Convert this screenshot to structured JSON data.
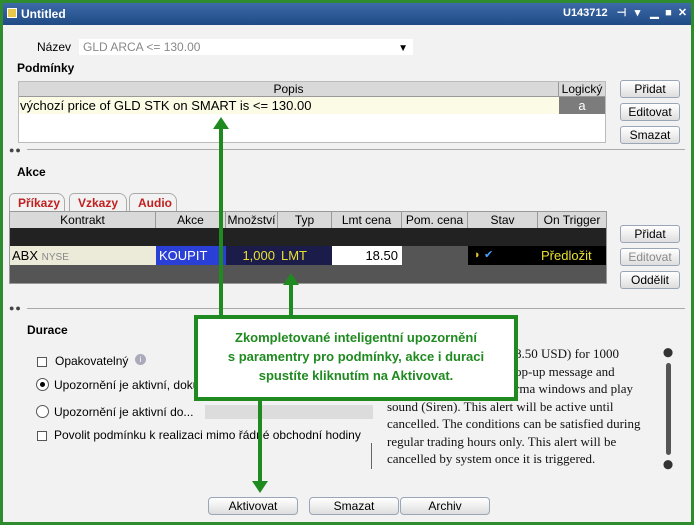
{
  "window": {
    "title": "Untitled",
    "account": "U143712",
    "title_color": "#2a5796"
  },
  "name_row": {
    "label": "Název",
    "value": "GLD ARCA <= 130.00"
  },
  "conditions": {
    "section_label": "Podmínky",
    "columns": [
      "Popis",
      "Logický"
    ],
    "row": {
      "description": "výchozí price of GLD STK on SMART is <= 130.00",
      "logical": "a"
    },
    "buttons": [
      "Přidat",
      "Editovat",
      "Smazat"
    ]
  },
  "actions": {
    "section_label": "Akce",
    "tabs": [
      "Příkazy",
      "Vzkazy",
      "Audio"
    ],
    "columns": [
      "Kontrakt",
      "Akce",
      "Množství",
      "Typ",
      "Lmt cena",
      "Pom. cena",
      "Stav",
      "On Trigger"
    ],
    "row": {
      "contract": "ABX",
      "exchange": "NYSE",
      "action": "KOUPIT",
      "quantity": "1,000",
      "type": "LMT",
      "limit_price": "18.50",
      "aux_price": "",
      "on_trigger": "Předložit"
    },
    "buttons": [
      "Přidat",
      "Editovat",
      "Oddělit"
    ]
  },
  "duration": {
    "section_label": "Durace",
    "repeatable_label": "Opakovatelný",
    "radio_active_label": "Upozornění je aktivní, doku",
    "radio_until_label": "Upozornění je aktivní do...",
    "outside_hours_label": "Povolit podmínku k realizaci mimo řádné obchodní hodiny",
    "summary_lines": [
      "8.50 USD) for 1000",
      "op-up message and",
      "rma windows and play",
      "sound (Siren). This alert will be active until",
      "cancelled. The conditions can be satisfied during",
      "regular trading hours only. This alert will be",
      "cancelled by system once it is triggered."
    ]
  },
  "bottom_buttons": [
    "Aktivovat",
    "Smazat",
    "Archiv"
  ],
  "annotation": {
    "text_lines": [
      "Zkompletované inteligentní upozornění",
      "s paramentry pro podmínky, akce i duraci",
      "spustíte kliknutím na Aktivovat."
    ],
    "color": "#1f8a1f"
  }
}
